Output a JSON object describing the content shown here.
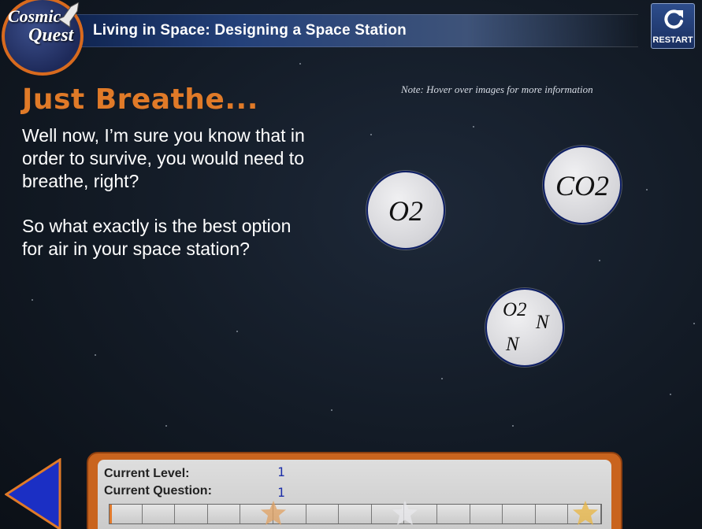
{
  "header": {
    "logo": {
      "line1": "Cosmic",
      "line2": "Quest"
    },
    "title": "Living in Space: Designing a Space Station",
    "restart_label": "RESTART"
  },
  "content": {
    "heading": "Just Breathe...",
    "note": "Note: Hover over images for more information",
    "paragraph1": "Well now, I’m sure you know that in order to survive, you would need to breathe, right?",
    "paragraph2": "So what exactly is the best option for air in your space station?"
  },
  "options": {
    "o2": {
      "label": "O2"
    },
    "co2": {
      "label": "CO2"
    },
    "mix": {
      "o2": "O2",
      "n1": "N",
      "n2": "N"
    }
  },
  "status": {
    "level_label": "Current Level:",
    "level_value": "1",
    "question_label": "Current Question:",
    "question_value": "1",
    "progress_segments": 15,
    "progress_filled": 0.005,
    "star_positions": [
      5,
      9,
      15
    ]
  },
  "colors": {
    "accent_orange": "#e07a28",
    "title_bar_blue": "#24417a",
    "value_blue": "#1d2fa8"
  },
  "icons": {
    "restart": "restart-icon",
    "back": "back-arrow-icon",
    "star": "star-icon"
  }
}
